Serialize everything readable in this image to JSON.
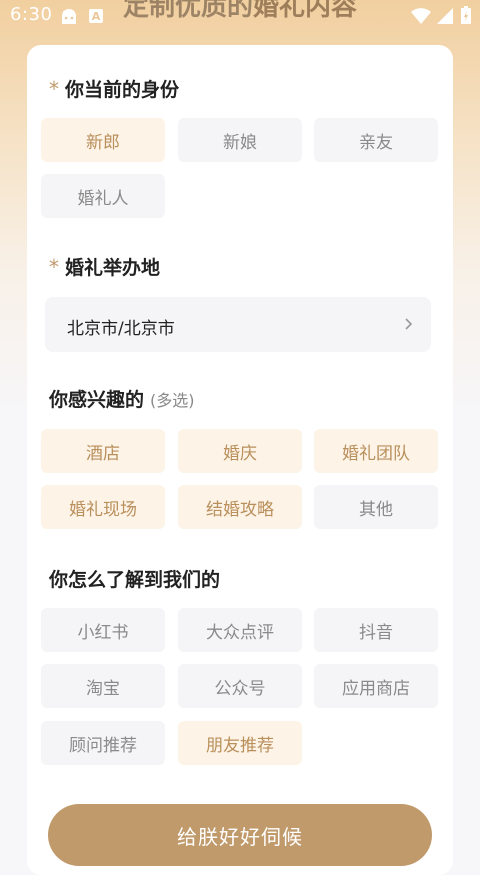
{
  "status_bar": {
    "time": "6:30",
    "notification_badge": "A"
  },
  "background_title": {
    "prefix": "定制优质的",
    "highlight": "婚礼内容"
  },
  "identity": {
    "title": "你当前的身份",
    "required_mark": "*",
    "options": [
      {
        "label": "新郎",
        "selected": true
      },
      {
        "label": "新娘",
        "selected": false
      },
      {
        "label": "亲友",
        "selected": false
      },
      {
        "label": "婚礼人",
        "selected": false
      }
    ]
  },
  "venue": {
    "title": "婚礼举办地",
    "required_mark": "*",
    "value": "北京市/北京市"
  },
  "interests": {
    "title": "你感兴趣的",
    "subtitle": "(多选)",
    "options": [
      {
        "label": "酒店",
        "selected": true
      },
      {
        "label": "婚庆",
        "selected": true
      },
      {
        "label": "婚礼团队",
        "selected": true
      },
      {
        "label": "婚礼现场",
        "selected": true
      },
      {
        "label": "结婚攻略",
        "selected": true
      },
      {
        "label": "其他",
        "selected": false
      }
    ]
  },
  "source": {
    "title": "你怎么了解到我们的",
    "options": [
      {
        "label": "小红书",
        "selected": false
      },
      {
        "label": "大众点评",
        "selected": false
      },
      {
        "label": "抖音",
        "selected": false
      },
      {
        "label": "淘宝",
        "selected": false
      },
      {
        "label": "公众号",
        "selected": false
      },
      {
        "label": "应用商店",
        "selected": false
      },
      {
        "label": "顾问推荐",
        "selected": false
      },
      {
        "label": "朋友推荐",
        "selected": true
      }
    ]
  },
  "submit_label": "给朕好好伺候",
  "colors": {
    "accent": "#c19a6b",
    "selected_bg": "#fdf3e6",
    "chip_bg": "#f5f5f7"
  }
}
